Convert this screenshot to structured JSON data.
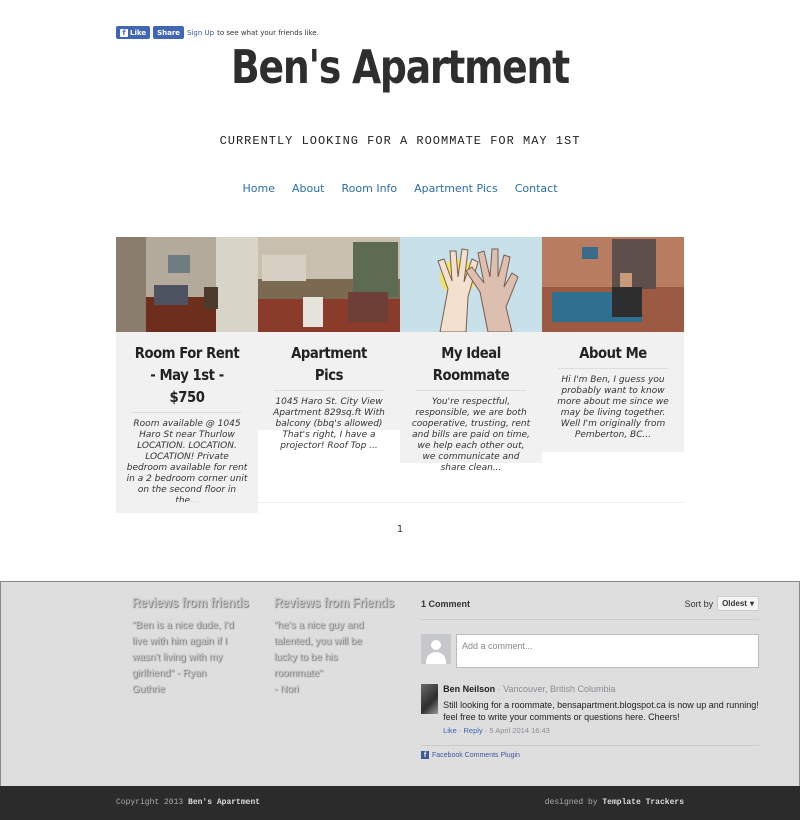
{
  "fb": {
    "like": "Like",
    "share": "Share",
    "signup": "Sign Up",
    "rest": " to see what your friends like."
  },
  "site": {
    "title": "Ben's Apartment",
    "tagline": "CURRENTLY LOOKING FOR A ROOMMATE FOR MAY 1ST"
  },
  "nav": [
    "Home",
    "About",
    "Room Info",
    "Apartment Pics",
    "Contact"
  ],
  "posts": [
    {
      "title": "Room For Rent - May 1st - $750",
      "excerpt": "Room available @ 1045 Haro St near Thurlow LOCATION. LOCATION. LOCATION!  Private bedroom available for rent in a 2 bedroom corner unit on the second floor in the..."
    },
    {
      "title": "Apartment Pics",
      "excerpt": "1045 Haro St. City View Apartment 829sq.ft With balcony (bbq's allowed) That's right, I have a projector! Roof Top ..."
    },
    {
      "title": "My Ideal Roommate",
      "excerpt": "You're respectful, responsible, we are both cooperative, trusting, rent and bills are paid on time, we help each other out, we communicate and share clean..."
    },
    {
      "title": "About Me",
      "excerpt": "Hi I'm Ben, I guess you probably want to know more about me since we may be living together. Well I'm originally from Pemberton, BC..."
    }
  ],
  "pager": {
    "current": "1"
  },
  "reviews": [
    {
      "title": "Reviews from friends",
      "text": "\"Ben is a nice dude, I'd live with him again if I wasn't living with my girlfriend\" - Ryan Guthrie"
    },
    {
      "title": "Reviews from Friends",
      "text": "\"he's a nice guy and talented, you will be lucky to be his roommate\"\n- Nori"
    }
  ],
  "comments": {
    "count": "1 Comment",
    "sort_label": "Sort by",
    "sort_value": "Oldest",
    "placeholder": "Add a comment...",
    "items": [
      {
        "name": "Ben Neilson",
        "location": "Vancouver, British Columbia",
        "text": "Still looking for a roommate, bensapartment.blogspot.ca is now up and running! feel free to write your comments or questions here. Cheers!",
        "like": "Like",
        "reply": "Reply",
        "date": "5 April 2014 16:43"
      }
    ],
    "plugin": "Facebook Comments Plugin"
  },
  "footer": {
    "copyright": "Copyright 2013",
    "site": "Ben's Apartment",
    "designed": "designed by",
    "designer": "Template Trackers"
  }
}
